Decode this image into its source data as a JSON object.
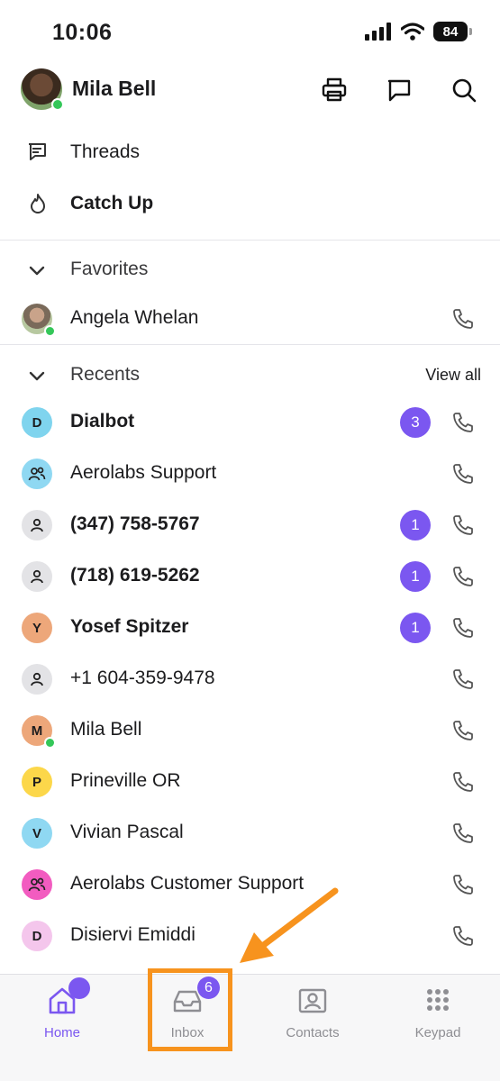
{
  "status": {
    "time": "10:06",
    "battery": "84"
  },
  "header": {
    "name": "Mila Bell"
  },
  "nav": [
    {
      "label": "Threads",
      "icon": "threads-icon"
    },
    {
      "label": "Catch Up",
      "icon": "flame-icon"
    }
  ],
  "favorites": {
    "title": "Favorites",
    "items": [
      {
        "name": "Angela Whelan"
      }
    ]
  },
  "recents": {
    "title": "Recents",
    "view_all": "View all",
    "items": [
      {
        "name": "Dialbot",
        "initial": "D",
        "color": "#7fd4ee",
        "bold": true,
        "badge": "3"
      },
      {
        "name": "Aerolabs Support",
        "initial": "",
        "color": "#8fd8f2",
        "bold": false,
        "badge": "",
        "icon": "group-icon"
      },
      {
        "name": "(347) 758-5767",
        "initial": "",
        "color": "#e3e3e6",
        "bold": true,
        "badge": "1",
        "icon": "person-icon"
      },
      {
        "name": "(718) 619-5262",
        "initial": "",
        "color": "#e3e3e6",
        "bold": true,
        "badge": "1",
        "icon": "person-icon"
      },
      {
        "name": "Yosef Spitzer",
        "initial": "Y",
        "color": "#eda77a",
        "bold": true,
        "badge": "1"
      },
      {
        "name": "+1 604-359-9478",
        "initial": "",
        "color": "#e3e3e6",
        "bold": false,
        "badge": "",
        "icon": "person-icon"
      },
      {
        "name": "Mila Bell",
        "initial": "M",
        "color": "#eda77a",
        "bold": false,
        "badge": "",
        "online": true
      },
      {
        "name": "Prineville OR",
        "initial": "P",
        "color": "#fcd74a",
        "bold": false,
        "badge": ""
      },
      {
        "name": "Vivian Pascal",
        "initial": "V",
        "color": "#8fd8f2",
        "bold": false,
        "badge": ""
      },
      {
        "name": "Aerolabs Customer Support",
        "initial": "",
        "color": "#f25cc0",
        "bold": false,
        "badge": "",
        "icon": "group-icon"
      },
      {
        "name": "Disiervi Emiddi",
        "initial": "D",
        "color": "#f4c6ec",
        "bold": false,
        "badge": ""
      }
    ]
  },
  "tabs": {
    "home": "Home",
    "inbox": "Inbox",
    "inbox_badge": "6",
    "contacts": "Contacts",
    "keypad": "Keypad"
  },
  "colors": {
    "accent": "#7b57f0",
    "annotation": "#f7931e",
    "online": "#34c759"
  }
}
